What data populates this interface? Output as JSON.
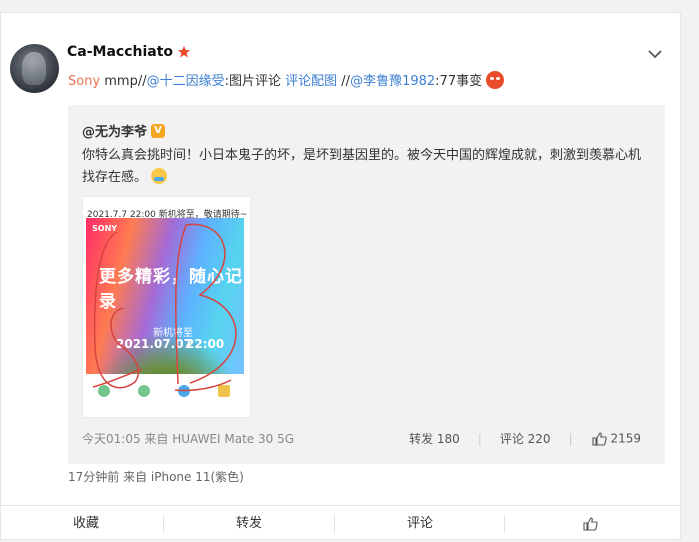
{
  "post": {
    "author": "Ca-Macchiato",
    "text_parts": {
      "sony": "Sony",
      "mmp": " mmp//",
      "mention1": "@十二因缘受",
      "mention1_tail": ":图片评论 ",
      "link": "评论配图",
      "sep": " //",
      "mention2": "@李鲁豫1982",
      "tail": ":77事变"
    },
    "meta": "17分钟前  来自 iPhone 11(紫色)"
  },
  "quoted": {
    "author": "@无为李爷",
    "verified_mark": "V",
    "text": "你特么真会挑时间！小日本鬼子的坏，是坏到基因里的。被今天中国的辉煌成就，刺激到羡慕心机找存在感。",
    "image": {
      "top_text": "2021.7.7 22:00 新机将至，敬请期待~",
      "brand": "SONY",
      "headline": "更多精彩，随心记录",
      "subline": "新机将至",
      "date": "2021.07.07",
      "time": "22:00"
    },
    "meta_left": "今天01:05 来自 HUAWEI Mate 30 5G",
    "repost": "转发 180",
    "comment": "评论 220",
    "likes": "2159"
  },
  "actions": {
    "favorite": "收藏",
    "repost": "转发",
    "comment": "评论"
  },
  "colors": {
    "link": "#eb7350",
    "mention": "#3c7fd2",
    "background": "#f2f2f5"
  }
}
